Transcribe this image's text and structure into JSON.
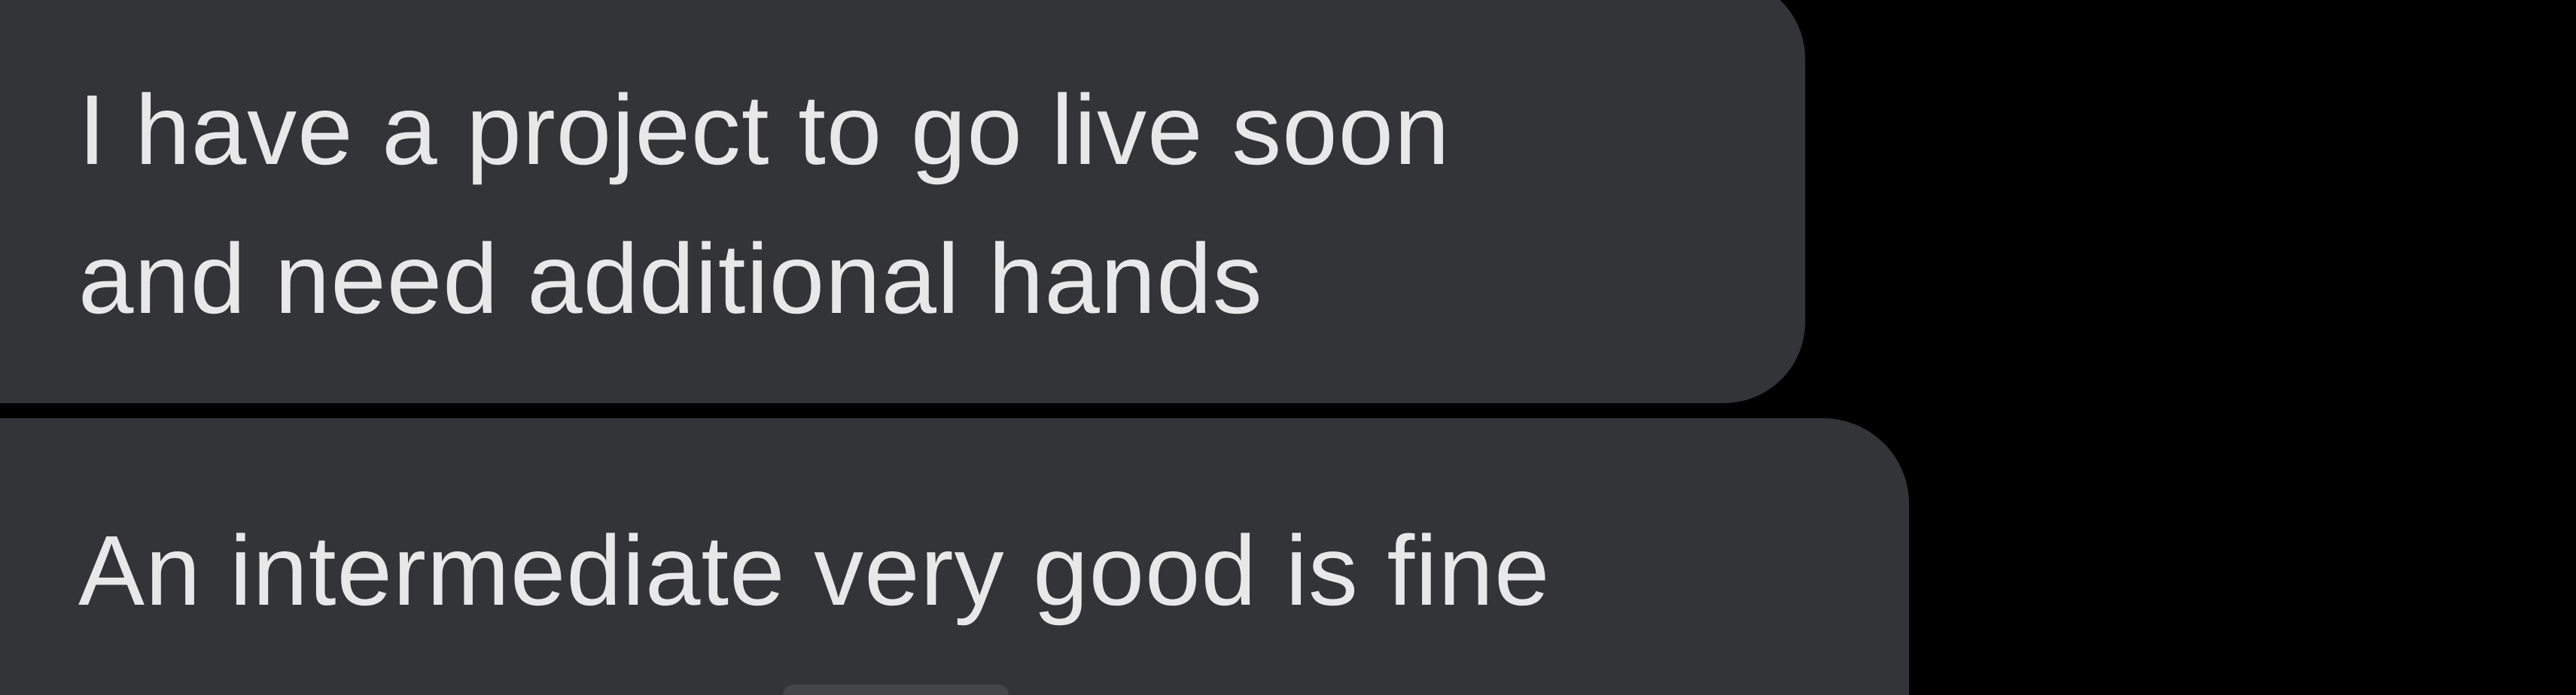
{
  "conversation": {
    "messages": [
      {
        "lines": [
          "I have a project to go live soon",
          "and need additional hands"
        ]
      },
      {
        "lines": [
          "An intermediate very good is fine"
        ]
      }
    ]
  },
  "colors": {
    "background": "#000000",
    "bubble": "#323438",
    "text": "#e8e8e8"
  }
}
